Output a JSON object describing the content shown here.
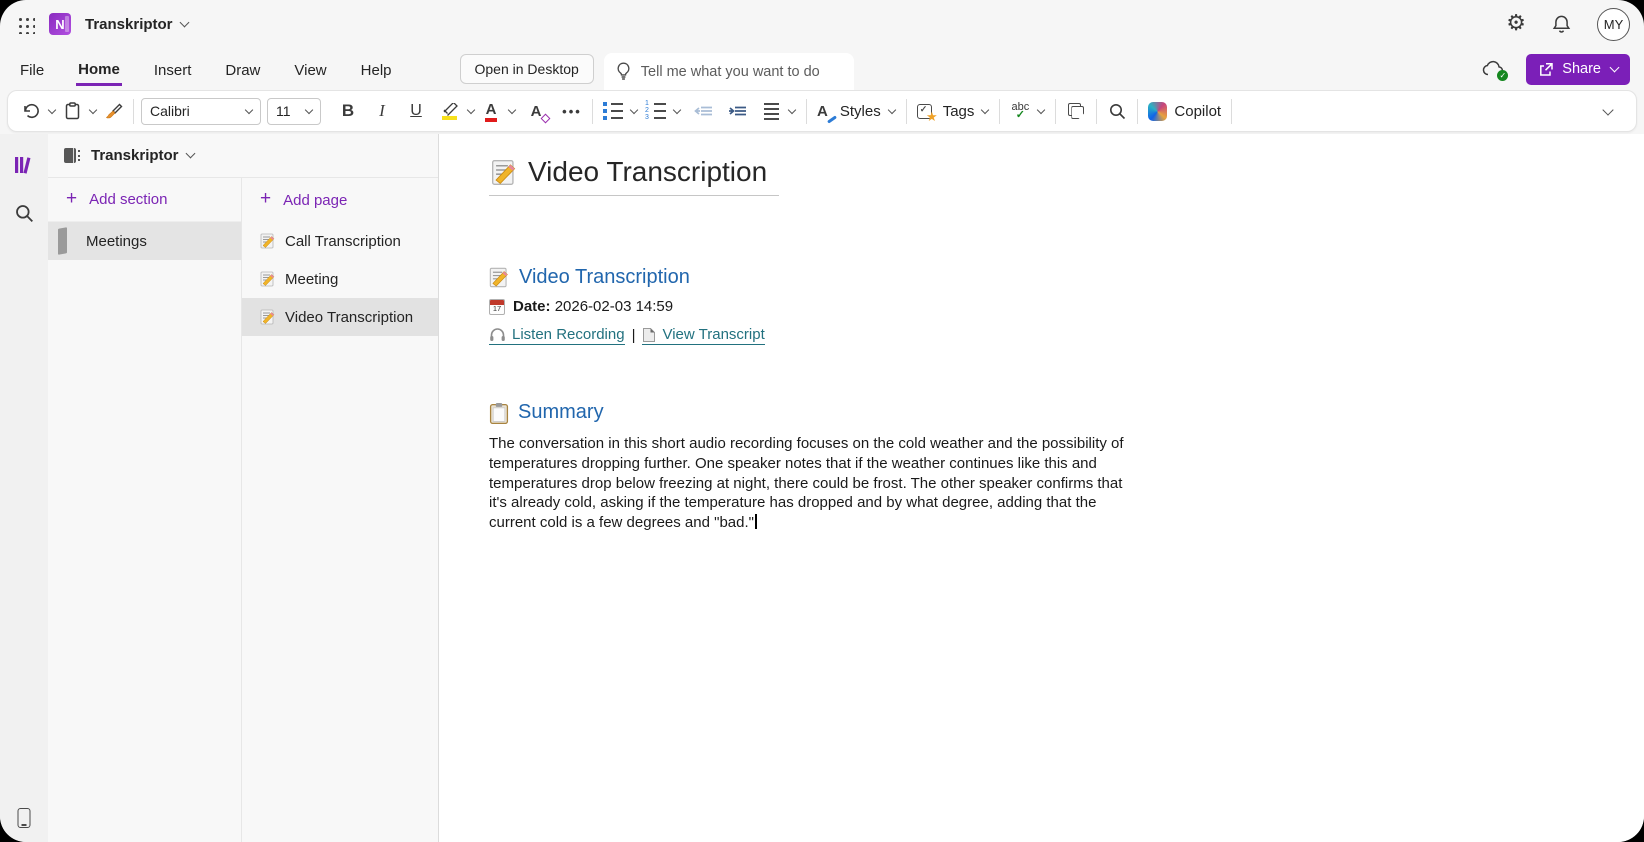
{
  "header": {
    "app_title": "Transkriptor",
    "avatar_initials": "MY"
  },
  "menu": {
    "items": [
      "File",
      "Home",
      "Insert",
      "Draw",
      "View",
      "Help"
    ],
    "active_item": "Home",
    "open_in_desktop_label": "Open in Desktop",
    "tell_me_placeholder": "Tell me what you want to do",
    "share_label": "Share"
  },
  "toolbar": {
    "font_name": "Calibri",
    "font_size": "11",
    "bold_glyph": "B",
    "italic_glyph": "I",
    "underline_glyph": "U",
    "font_color_glyph": "A",
    "clear_format_glyph": "A",
    "ellipsis_glyph": "•••",
    "styles_glyph": "A",
    "styles_label": "Styles",
    "tags_label": "Tags",
    "spellcheck_text": "abc",
    "spellcheck_check": "✓",
    "copilot_label": "Copilot",
    "tags_check": "✓",
    "tags_star": "★"
  },
  "sidebar": {
    "notebook_name": "Transkriptor",
    "add_section_label": "Add section",
    "add_page_label": "Add page",
    "plus_glyph": "+",
    "sections": [
      {
        "label": "Meetings",
        "selected": true
      }
    ],
    "pages": [
      {
        "label": "Call Transcription",
        "selected": false
      },
      {
        "label": "Meeting",
        "selected": false
      },
      {
        "label": "Video Transcription",
        "selected": true
      }
    ]
  },
  "page": {
    "title": "Video Transcription",
    "heading": "Video Transcription",
    "date_label": "Date:",
    "date_value": "2026-02-03 14:59",
    "calendar_day": "17",
    "link_listen": "Listen Recording",
    "links_separator": "|",
    "link_transcript": "View Transcript",
    "summary_heading": "Summary",
    "summary_text": "The conversation in this short audio recording focuses on the cold weather and the possibility of temperatures dropping further. One speaker notes that if the weather continues like this and temperatures drop below freezing at night, there could be frost. The other speaker confirms that it's already cold, asking if the temperature has dropped and by what degree, adding that the current cold is a few degrees and \"bad.\""
  },
  "colors": {
    "accent_purple": "#7b24b4",
    "heading_blue": "#2166ad",
    "link_teal": "#22717f",
    "share_purple": "#7b1fb8"
  },
  "icons": {
    "gear_glyph": "⚙"
  }
}
